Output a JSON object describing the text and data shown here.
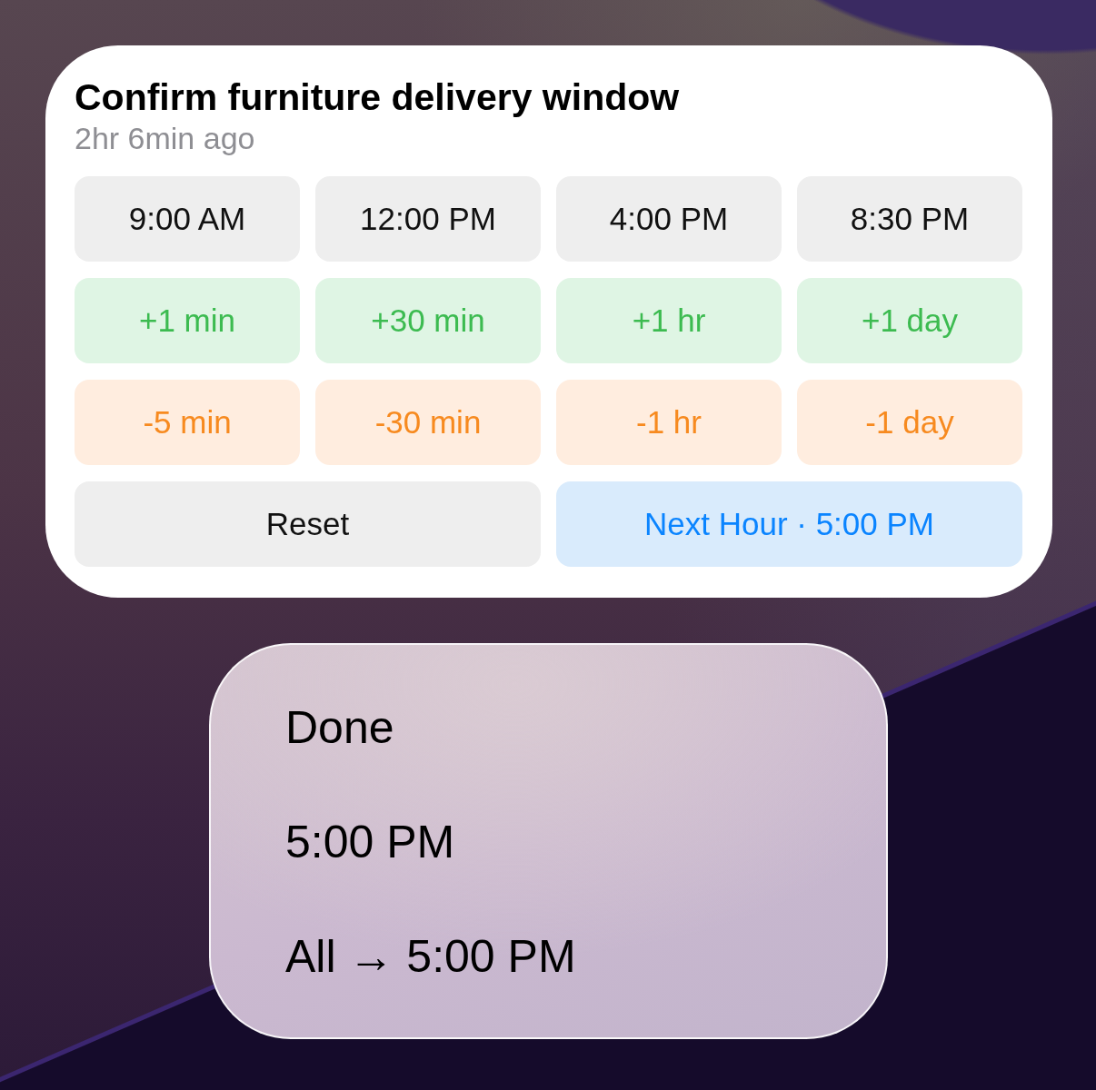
{
  "notification": {
    "title": "Confirm furniture delivery window",
    "time": "2hr 6min ago",
    "button_rows": [
      [
        {
          "label": "9:00 AM",
          "kind": "preset"
        },
        {
          "label": "12:00 PM",
          "kind": "preset"
        },
        {
          "label": "4:00 PM",
          "kind": "preset"
        },
        {
          "label": "8:30 PM",
          "kind": "preset"
        }
      ],
      [
        {
          "label": "+1 min",
          "kind": "add"
        },
        {
          "label": "+30 min",
          "kind": "add"
        },
        {
          "label": "+1 hr",
          "kind": "add"
        },
        {
          "label": "+1 day",
          "kind": "add"
        }
      ],
      [
        {
          "label": "-5 min",
          "kind": "subtract"
        },
        {
          "label": "-30 min",
          "kind": "subtract"
        },
        {
          "label": "-1 hr",
          "kind": "subtract"
        },
        {
          "label": "-1 day",
          "kind": "subtract"
        }
      ],
      [
        {
          "label": "Reset",
          "kind": "reset"
        },
        {
          "label": "Next Hour · 5:00 PM",
          "kind": "next"
        }
      ]
    ]
  },
  "menu": {
    "items": [
      "Done",
      "5:00 PM",
      "All → 5:00 PM"
    ]
  }
}
